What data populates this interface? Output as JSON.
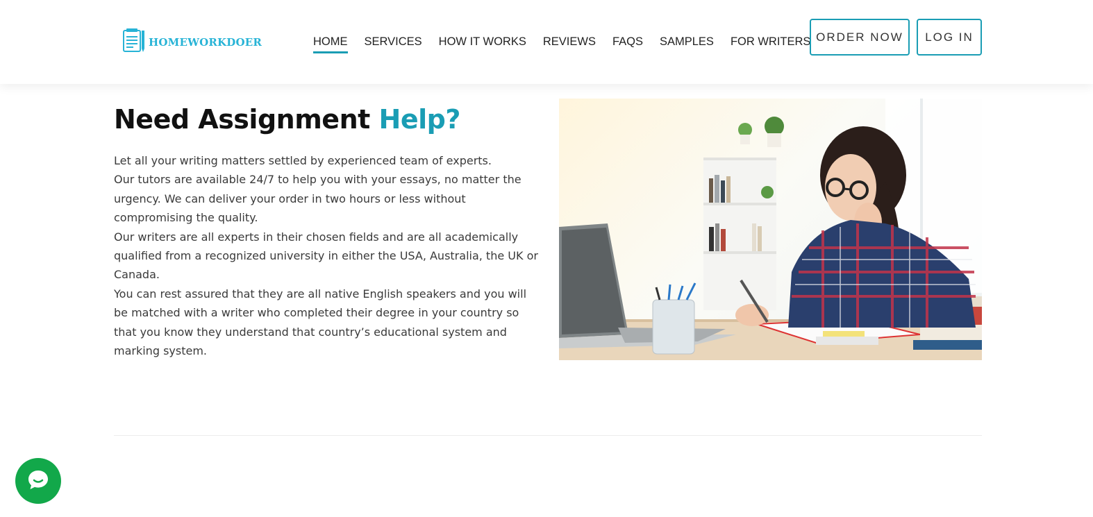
{
  "brand": {
    "logo_text": "HOMEWORKDOER",
    "logo_icon": "notepad-pencil-icon",
    "accent_color": "#1a9db4",
    "logo_color": "#27b3d6"
  },
  "nav": {
    "items": [
      {
        "label": "HOME",
        "active": true
      },
      {
        "label": "SERVICES",
        "active": false
      },
      {
        "label": "HOW IT WORKS",
        "active": false
      },
      {
        "label": "REVIEWS",
        "active": false
      },
      {
        "label": "FAQS",
        "active": false
      },
      {
        "label": "SAMPLES",
        "active": false
      },
      {
        "label": "FOR WRITERS",
        "active": false
      }
    ],
    "order_button": "ORDER NOW",
    "login_button": "LOG IN"
  },
  "hero": {
    "title_main": "Need Assignment",
    "title_accent": "Help?",
    "paragraphs": [
      "Let all your writing matters settled by experienced team of experts.",
      "Our tutors are available 24/7 to help you with your essays, no matter the urgency. We can deliver your order in two hours or less without compromising the quality.",
      "Our writers are all experts in their chosen fields and are all academically qualified from a recognized university in either the USA, Australia, the UK or Canada.",
      "You can rest assured that they are all native English speakers and you will be matched with a writer who completed their degree in your country so that you know they understand that country’s educational system and marking system."
    ]
  },
  "chat": {
    "icon": "chat-bubble-icon",
    "color": "#12a84a"
  }
}
